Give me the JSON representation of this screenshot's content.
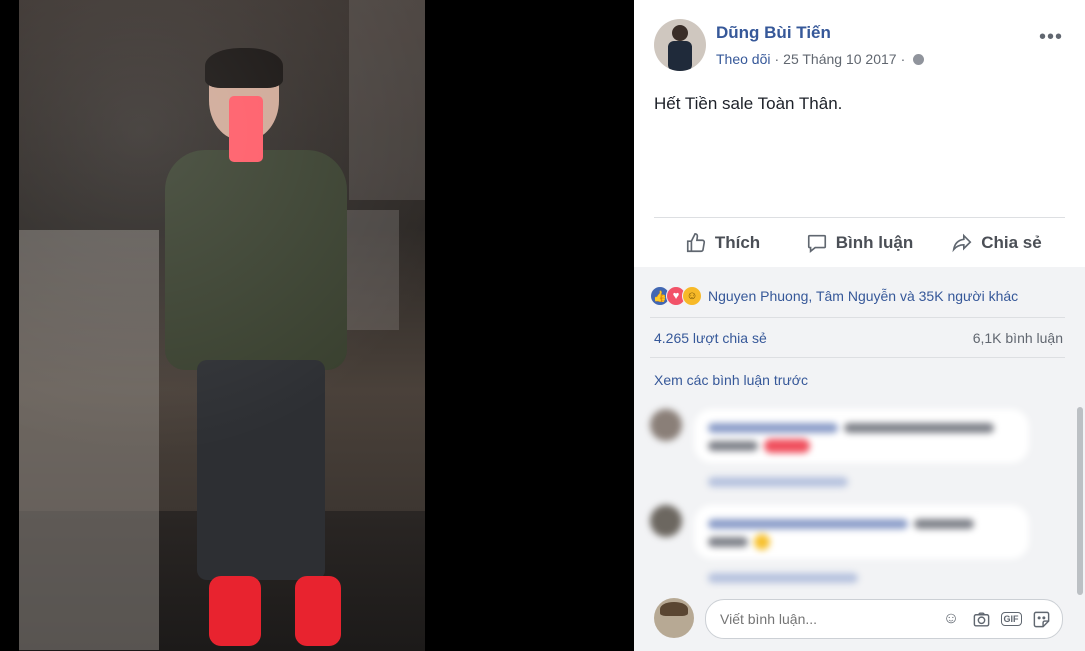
{
  "post": {
    "author": "Dũng Bùi Tiến",
    "follow": "Theo dõi",
    "date": "25 Tháng 10 2017",
    "text": "Hết Tiền sale Toàn Thân."
  },
  "actions": {
    "like": "Thích",
    "comment": "Bình luận",
    "share": "Chia sẻ"
  },
  "engagement": {
    "reactors": "Nguyen Phuong, Tâm Nguyễn và 35K người khác",
    "shares": "4.265 lượt chia sẻ",
    "comments": "6,1K bình luận",
    "view_previous": "Xem các bình luận trước"
  },
  "compose": {
    "placeholder": "Viết bình luận..."
  },
  "icons": [
    "globe-icon",
    "more-icon",
    "like-icon",
    "comment-icon",
    "share-icon",
    "emoji-icon",
    "camera-icon",
    "gif-icon",
    "sticker-icon"
  ],
  "colors": {
    "link": "#365899",
    "like_reaction": "#4267b2",
    "love_reaction": "#f25268",
    "haha_reaction": "#f7b928"
  }
}
